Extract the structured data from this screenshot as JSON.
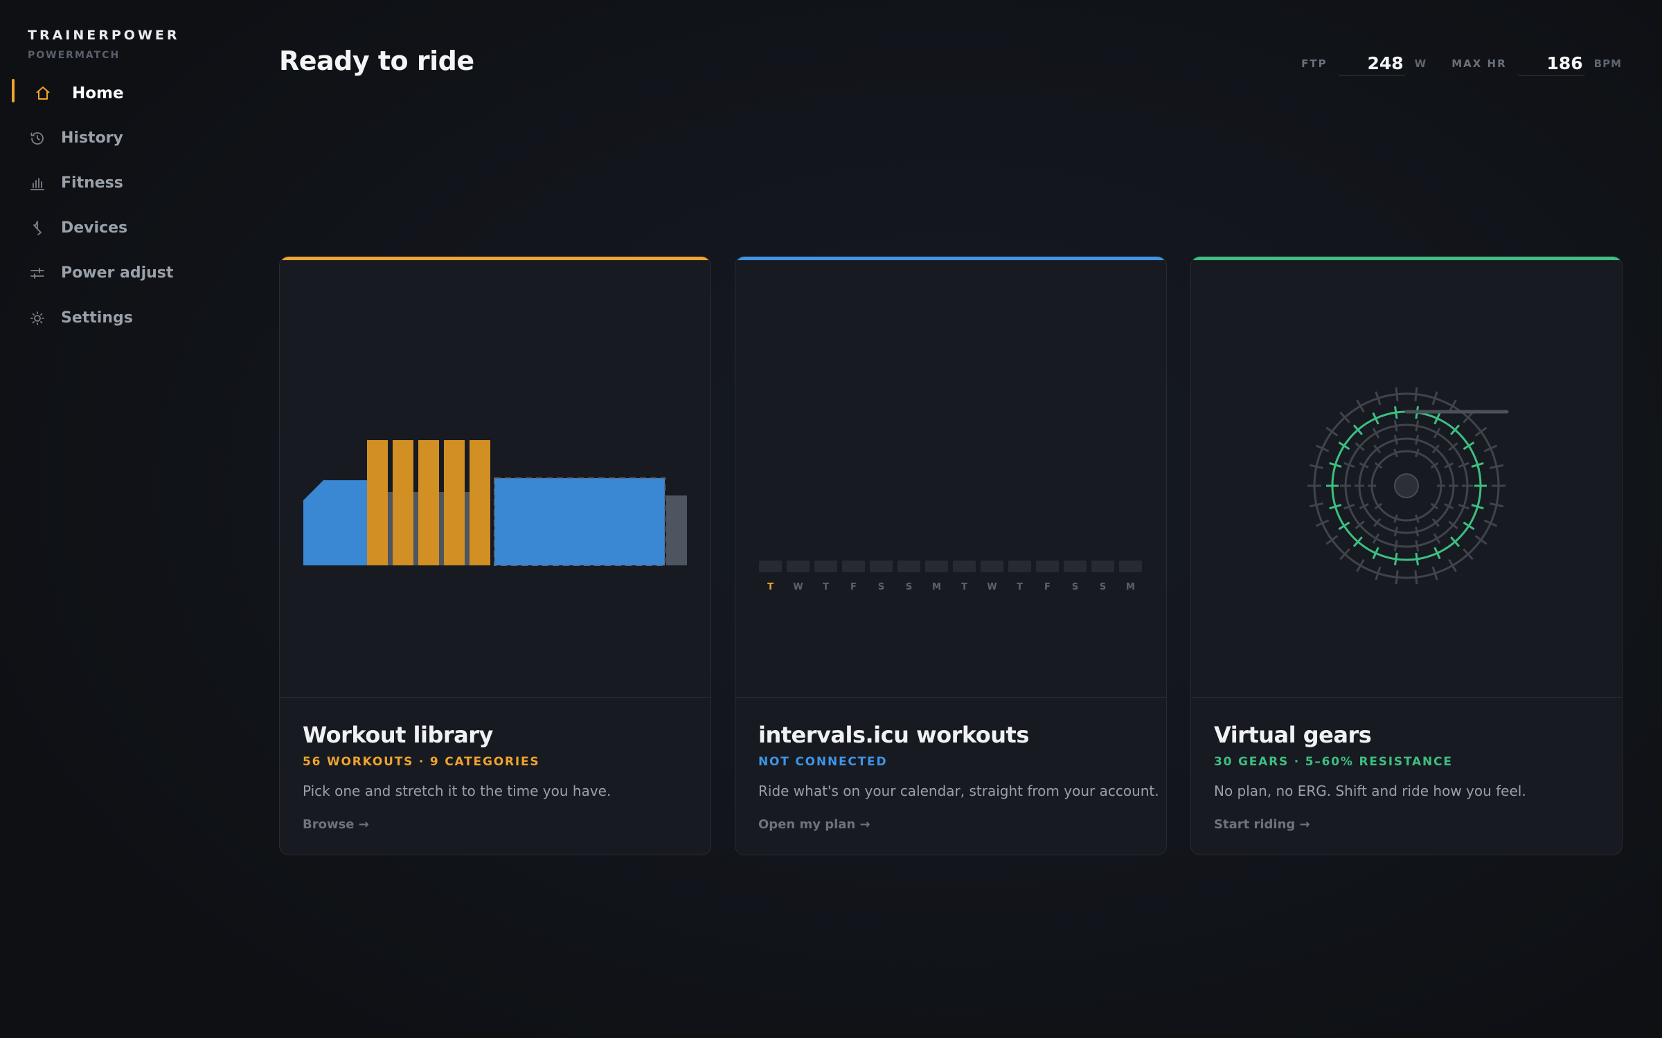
{
  "brand": {
    "name": "TRAINERPOWER",
    "sub": "POWERMATCH"
  },
  "nav": [
    {
      "label": "Home",
      "icon": "home-icon",
      "active": true
    },
    {
      "label": "History",
      "icon": "history-icon"
    },
    {
      "label": "Fitness",
      "icon": "bar-chart-icon"
    },
    {
      "label": "Devices",
      "icon": "bluetooth-icon"
    },
    {
      "label": "Power adjust",
      "icon": "sliders-icon"
    },
    {
      "label": "Settings",
      "icon": "gear-icon"
    }
  ],
  "header": {
    "title": "Ready to ride",
    "ftp": {
      "label": "FTP",
      "value": "248",
      "unit": "W"
    },
    "max_hr": {
      "label": "MAX HR",
      "value": "186",
      "unit": "BPM"
    }
  },
  "cards": [
    {
      "title": "Workout library",
      "subtitle": "56 WORKOUTS · 9 CATEGORIES",
      "description": "Pick one and stretch it to the time you have.",
      "link": "Browse →",
      "accent": "#f0a32e"
    },
    {
      "title": "intervals.icu workouts",
      "subtitle": "NOT CONNECTED",
      "description": "Ride what's on your calendar, straight from your account.",
      "link": "Open my plan →",
      "accent": "#3f94e6",
      "calendar_days": [
        "T",
        "W",
        "T",
        "F",
        "S",
        "S",
        "M",
        "T",
        "W",
        "T",
        "F",
        "S",
        "S",
        "M"
      ]
    },
    {
      "title": "Virtual gears",
      "subtitle": "30 GEARS · 5–60% RESISTANCE",
      "description": "No plan, no ERG. Shift and ride how you feel.",
      "link": "Start riding →",
      "accent": "#3dbf82"
    }
  ]
}
